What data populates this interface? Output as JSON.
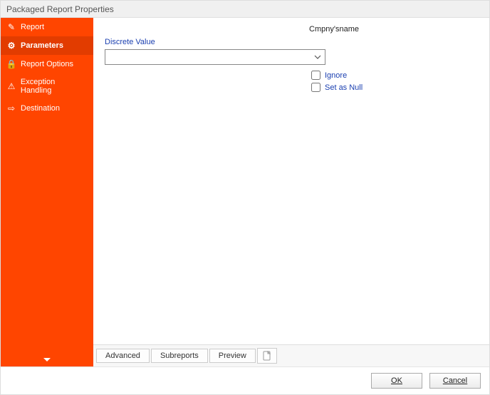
{
  "window": {
    "title": "Packaged Report Properties"
  },
  "sidebar": {
    "items": [
      {
        "label": "Report",
        "icon": "✎"
      },
      {
        "label": "Parameters",
        "icon": "⚙",
        "selected": true
      },
      {
        "label": "Report Options",
        "icon": "🔒"
      },
      {
        "label": "Exception Handling",
        "icon": "⚠"
      },
      {
        "label": "Destination",
        "icon": "⇨"
      }
    ]
  },
  "main": {
    "header": "Cmpny'sname",
    "field_label": "Discrete Value",
    "combo_value": "",
    "checkboxes": {
      "ignore": "Ignore",
      "set_null": "Set as Null"
    },
    "tabs": {
      "advanced": "Advanced",
      "subreports": "Subreports",
      "preview": "Preview"
    }
  },
  "footer": {
    "ok": "OK",
    "cancel": "Cancel"
  }
}
